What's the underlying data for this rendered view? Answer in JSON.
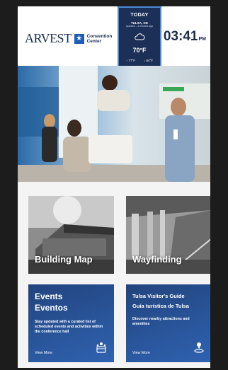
{
  "header": {
    "logo_name": "ARVEST",
    "logo_sub_line1": "Convention",
    "logo_sub_line2": "Center",
    "time": "03:41",
    "ampm": "PM"
  },
  "weather": {
    "title": "TODAY",
    "city": "TULSA, OK",
    "updated": "Updated - 3 minutes ago",
    "condition_icon": "cloud-icon",
    "temp": "70°F",
    "high": "77°F",
    "low": "64°F"
  },
  "tiles": [
    {
      "title": "Building Map"
    },
    {
      "title": "Wayfinding"
    }
  ],
  "cards": [
    {
      "title_en": "Events",
      "title_es": "Eventos",
      "description": "Stay updated with a curated list of scheduled events and activities within the conference hall",
      "link": "View More",
      "icon": "calendar-people-icon"
    },
    {
      "title_en": "Tulsa Visitor's Guide",
      "title_es": "Guía turística de Tulsa",
      "description": "Discover nearby attractions and amenities",
      "link": "View More",
      "icon": "location-person-icon"
    }
  ]
}
